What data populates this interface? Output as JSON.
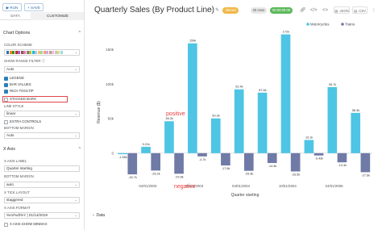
{
  "toolbar": {
    "run_label": "RUN",
    "save_label": "SAVE"
  },
  "tabs": [
    {
      "label": "DATA"
    },
    {
      "label": "CUSTOMIZE"
    }
  ],
  "chart_options": {
    "section_title": "Chart Options",
    "color_scheme_label": "COLOR SCHEME",
    "color_scheme_swatches": [
      "#1f77b4",
      "#ff7f0e",
      "#2ca02c",
      "#d62728",
      "#9467bd",
      "#8c564b",
      "#e377c2",
      "#7f7f7f",
      "#bcbd22",
      "#17becf",
      "#aec7e8",
      "#ffbb78",
      "#98df8a",
      "#ff9896",
      "#c5b0d5",
      "#c49c94",
      "#f7b6d2",
      "#c7c7c7",
      "#dbdb8d",
      "#9edae5"
    ],
    "range_filter_label": "SHOW RANGE FILTER",
    "range_filter_value": "Auto",
    "legend_label": "LEGEND",
    "bar_values_label": "BAR VALUES",
    "rich_tooltip_label": "RICH TOOLTIP",
    "stacked_bars_label": "STACKED BARS",
    "line_style_label": "LINE STYLE",
    "line_style_value": "linear",
    "extra_controls_label": "EXTRA CONTROLS",
    "bottom_margin_label": "BOTTOM MARGIN",
    "bottom_margin_value": "Auto"
  },
  "x_axis": {
    "section_title": "X Axis",
    "axis_label_label": "X AXIS LABEL",
    "axis_label_value": "Quarter starting",
    "bottom_margin_label": "BOTTOM MARGIN",
    "bottom_margin_value": "auto",
    "tick_layout_label": "X TICK LAYOUT",
    "tick_layout_value": "staggered",
    "axis_format_label": "X AXIS FORMAT",
    "axis_format_value": "%m/%d/%Y | 01/14/2019",
    "show_min_max_label": "X AXIS SHOW MINMAX"
  },
  "header": {
    "title": "Quarterly Sales (By Product Line)",
    "status_badge": "Altered",
    "rows_badge": "25 rows",
    "time_badge": "00:00:00.08",
    "json_label": ".JSON",
    "csv_label": ".CSV"
  },
  "annotations": {
    "positive": "positive",
    "negative": "negative"
  },
  "data_section": {
    "label": "Data"
  },
  "chart_data": {
    "type": "bar",
    "title": "",
    "xlabel": "Quarter starting",
    "ylabel": "Revenue ($)",
    "ylim": [
      -40000,
      175000
    ],
    "yticks": [
      0,
      50000,
      100000,
      150000
    ],
    "ytick_labels": [
      "0",
      "50k",
      "100k",
      "150k"
    ],
    "grid": false,
    "legend_position": "top-right",
    "x_ticks": [
      "04/01/2003",
      "10/01/2003",
      "04/01/2004",
      "10/01/2004",
      "04/01/2005"
    ],
    "x_tick_positions": [
      1,
      3,
      5,
      7,
      9
    ],
    "x_tick_labels": [
      "04/01/2003",
      "10/01/2003",
      "04/01/2004",
      "10/01/2004",
      "04/01/2005"
    ],
    "series": [
      {
        "name": "Motorcycles",
        "color": "#4ec5e4",
        "values": [
          -1580,
          9210,
          46200,
          159000,
          50300,
          92400,
          87600,
          172000,
          19100,
          95700,
          58300
        ],
        "labels": [
          "-1.58k",
          "9.21k",
          "46.2k",
          "159k",
          "50.3k",
          "92.4k",
          "87.6k",
          "172k",
          "19.1k",
          "95.7k",
          "58.3k"
        ]
      },
      {
        "name": "Trains",
        "color": "#6f7aa7",
        "values": [
          -30700,
          -25200,
          -29800,
          -4700,
          -17800,
          -25600,
          -14300,
          -26500,
          -3430,
          -13300,
          -27600
        ],
        "labels": [
          "-30.7k",
          "-25.2k",
          "-29.8k",
          "-4.7k",
          "-17.8k",
          "-25.6k",
          "-14.3k",
          "-26.5k",
          "-3.43k",
          "-13.3k",
          "-27.6k"
        ]
      }
    ]
  }
}
